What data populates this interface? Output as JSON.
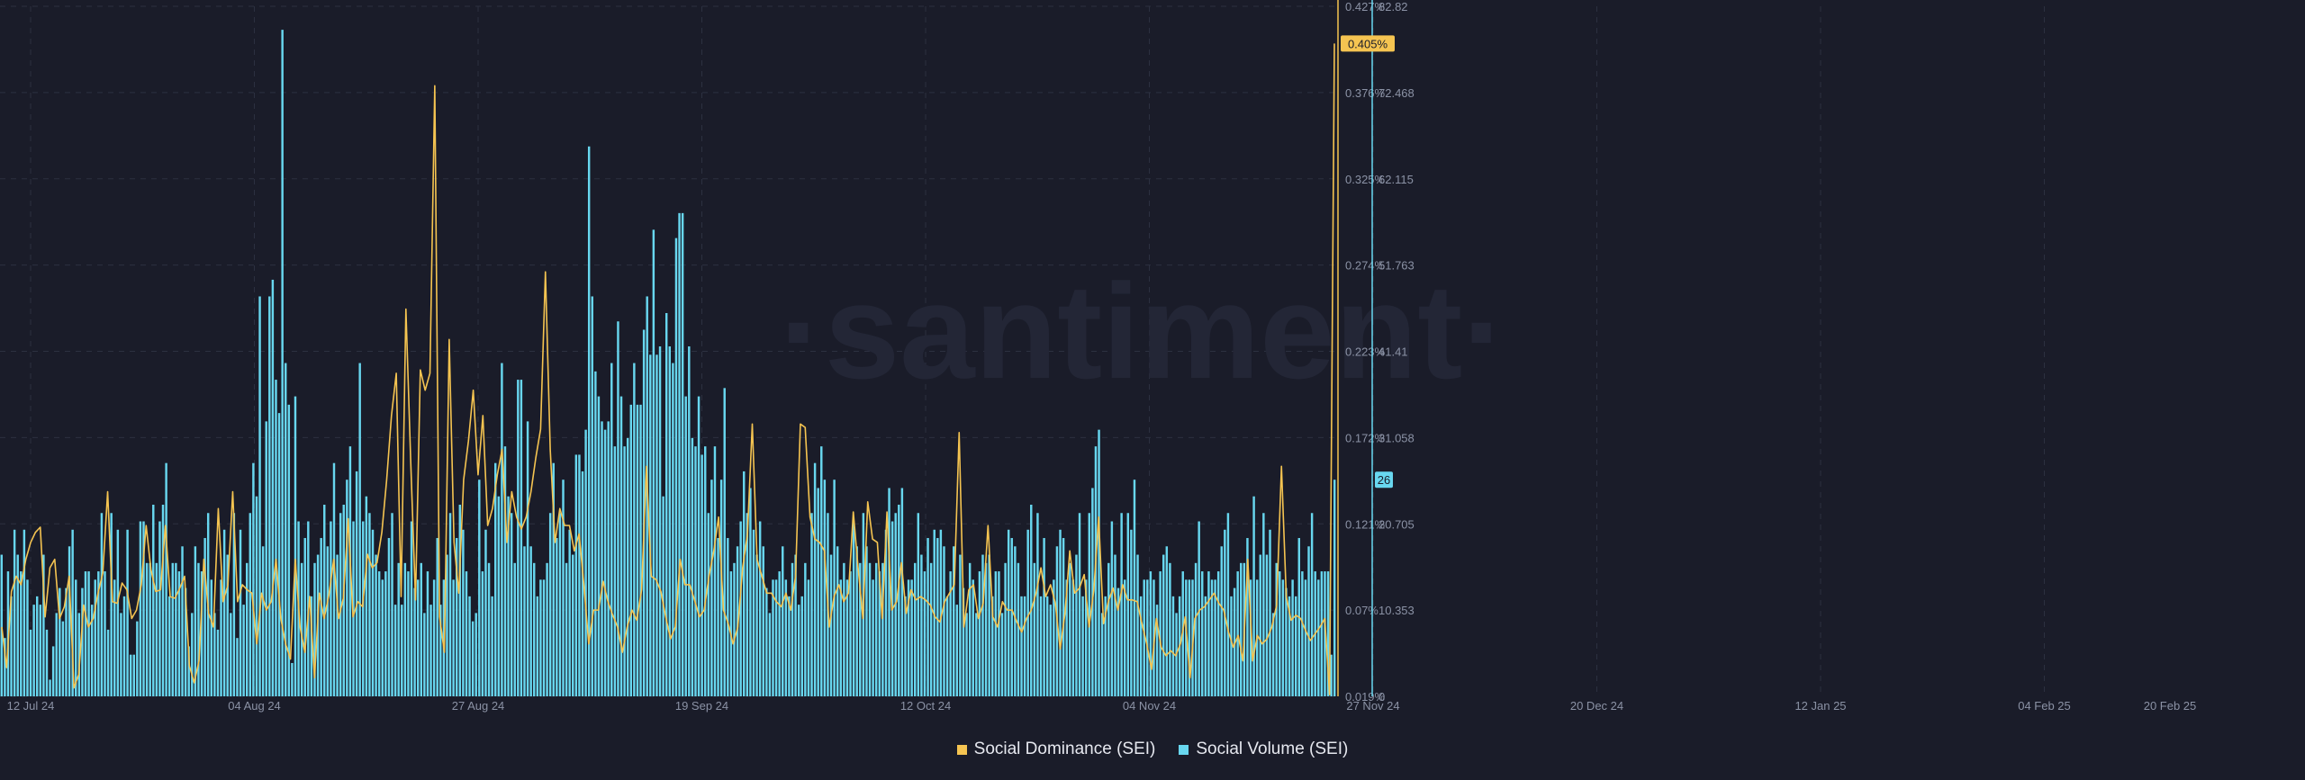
{
  "watermark": "·santiment·",
  "colors": {
    "background": "#1a1c29",
    "grid": "#2c3040",
    "dominance": "#f5c451",
    "volume": "#68d7ef",
    "axis_text": "#8b92a5"
  },
  "chart_data": {
    "type": "bar",
    "x_ticks": [
      "12 Jul 24",
      "04 Aug 24",
      "27 Aug 24",
      "19 Sep 24",
      "12 Oct 24",
      "04 Nov 24",
      "27 Nov 24",
      "20 Dec 24",
      "12 Jan 25",
      "04 Feb 25",
      "20 Feb 25"
    ],
    "y_left_ticks": [
      "0.427%",
      "0.376%",
      "0.325%",
      "0.274%",
      "0.223%",
      "0.172%",
      "0.121%",
      "0.07%",
      "0.019%"
    ],
    "y_right_ticks": [
      "82.82",
      "72.468",
      "62.115",
      "51.763",
      "41.41",
      "31.058",
      "20.705",
      "10.353",
      "0"
    ],
    "y_left_range": [
      0.019,
      0.427
    ],
    "y_right_range": [
      0,
      82.82
    ],
    "current_labels": {
      "dominance": "0.405%",
      "volume": "26"
    },
    "series": [
      {
        "name": "Social Dominance (SEI)",
        "type": "line",
        "axis": "left",
        "values": [
          0.06,
          0.036,
          0.081,
          0.09,
          0.085,
          0.1,
          0.11,
          0.116,
          0.119,
          0.066,
          0.095,
          0.1,
          0.065,
          0.072,
          0.09,
          0.024,
          0.032,
          0.073,
          0.06,
          0.065,
          0.08,
          0.092,
          0.14,
          0.075,
          0.074,
          0.086,
          0.082,
          0.065,
          0.07,
          0.085,
          0.12,
          0.094,
          0.081,
          0.082,
          0.12,
          0.078,
          0.077,
          0.083,
          0.09,
          0.037,
          0.027,
          0.04,
          0.1,
          0.068,
          0.06,
          0.13,
          0.075,
          0.085,
          0.14,
          0.075,
          0.085,
          0.082,
          0.08,
          0.05,
          0.08,
          0.07,
          0.075,
          0.1,
          0.065,
          0.05,
          0.041,
          0.1,
          0.06,
          0.045,
          0.078,
          0.03,
          0.08,
          0.065,
          0.079,
          0.1,
          0.065,
          0.077,
          0.124,
          0.066,
          0.075,
          0.072,
          0.103,
          0.095,
          0.098,
          0.116,
          0.147,
          0.185,
          0.21,
          0.078,
          0.248,
          0.158,
          0.076,
          0.212,
          0.2,
          0.21,
          0.38,
          0.066,
          0.045,
          0.23,
          0.11,
          0.08,
          0.147,
          0.17,
          0.2,
          0.15,
          0.185,
          0.12,
          0.13,
          0.15,
          0.165,
          0.11,
          0.14,
          0.125,
          0.118,
          0.125,
          0.14,
          0.16,
          0.177,
          0.27,
          0.165,
          0.11,
          0.13,
          0.12,
          0.12,
          0.105,
          0.115,
          0.085,
          0.05,
          0.07,
          0.07,
          0.087,
          0.075,
          0.067,
          0.06,
          0.045,
          0.06,
          0.07,
          0.064,
          0.082,
          0.155,
          0.09,
          0.088,
          0.081,
          0.066,
          0.053,
          0.06,
          0.1,
          0.085,
          0.085,
          0.076,
          0.066,
          0.07,
          0.09,
          0.105,
          0.125,
          0.07,
          0.062,
          0.05,
          0.06,
          0.095,
          0.115,
          0.18,
          0.1,
          0.09,
          0.08,
          0.08,
          0.075,
          0.072,
          0.08,
          0.07,
          0.09,
          0.18,
          0.178,
          0.125,
          0.112,
          0.11,
          0.105,
          0.06,
          0.078,
          0.085,
          0.075,
          0.08,
          0.128,
          0.095,
          0.065,
          0.134,
          0.112,
          0.11,
          0.065,
          0.128,
          0.07,
          0.075,
          0.098,
          0.068,
          0.082,
          0.076,
          0.078,
          0.076,
          0.073,
          0.066,
          0.063,
          0.075,
          0.08,
          0.085,
          0.175,
          0.06,
          0.082,
          0.085,
          0.065,
          0.074,
          0.12,
          0.066,
          0.06,
          0.075,
          0.07,
          0.07,
          0.063,
          0.057,
          0.065,
          0.07,
          0.08,
          0.095,
          0.078,
          0.085,
          0.074,
          0.047,
          0.068,
          0.105,
          0.08,
          0.083,
          0.091,
          0.06,
          0.082,
          0.125,
          0.062,
          0.075,
          0.083,
          0.07,
          0.085,
          0.076,
          0.076,
          0.075,
          0.062,
          0.05,
          0.035,
          0.065,
          0.048,
          0.043,
          0.046,
          0.043,
          0.05,
          0.066,
          0.03,
          0.065,
          0.07,
          0.072,
          0.076,
          0.08,
          0.074,
          0.07,
          0.057,
          0.048,
          0.055,
          0.04,
          0.1,
          0.04,
          0.055,
          0.05,
          0.053,
          0.06,
          0.073,
          0.155,
          0.078,
          0.064,
          0.067,
          0.065,
          0.058,
          0.052,
          0.056,
          0.06,
          0.065,
          0.02,
          0.405
        ]
      },
      {
        "name": "Social Volume (SEI)",
        "type": "bar",
        "axis": "right",
        "values": [
          17,
          7,
          15,
          12,
          20,
          17,
          15,
          20,
          14,
          8,
          11,
          12,
          11,
          17,
          8,
          2,
          6,
          10,
          13,
          9,
          13,
          18,
          20,
          14,
          10,
          13,
          15,
          15,
          11,
          14,
          15,
          22,
          15,
          8,
          22,
          14,
          20,
          10,
          12,
          20,
          5,
          5,
          9,
          21,
          21,
          16,
          16,
          23,
          16,
          21,
          23,
          28,
          12,
          16,
          16,
          15,
          18,
          13,
          6,
          10,
          18,
          16,
          15,
          19,
          22,
          14,
          10,
          8,
          14,
          20,
          17,
          10,
          22,
          7,
          20,
          11,
          16,
          22,
          28,
          24,
          48,
          18,
          33,
          48,
          50,
          38,
          34,
          80,
          40,
          35,
          4,
          36,
          21,
          16,
          19,
          21,
          12,
          16,
          17,
          19,
          23,
          18,
          21,
          28,
          17,
          22,
          23,
          26,
          30,
          21,
          27,
          40,
          21,
          24,
          22,
          20,
          17,
          15,
          14,
          15,
          19,
          22,
          11,
          16,
          11,
          16,
          15,
          21,
          13,
          14,
          16,
          10,
          15,
          11,
          14,
          19,
          11,
          14,
          17,
          22,
          14,
          19,
          23,
          20,
          15,
          12,
          9,
          10,
          26,
          15,
          20,
          16,
          12,
          28,
          24,
          40,
          30,
          24,
          22,
          16,
          38,
          38,
          18,
          33,
          18,
          16,
          12,
          14,
          14,
          16,
          22,
          28,
          19,
          22,
          26,
          16,
          20,
          17,
          29,
          29,
          27,
          32,
          66,
          48,
          39,
          36,
          33,
          32,
          33,
          40,
          30,
          45,
          36,
          30,
          31,
          35,
          40,
          35,
          35,
          44,
          48,
          41,
          56,
          41,
          42,
          24,
          46,
          42,
          40,
          55,
          58,
          58,
          36,
          42,
          31,
          30,
          36,
          29,
          30,
          22,
          26,
          30,
          19,
          26,
          37,
          19,
          15,
          16,
          18,
          21,
          27,
          22,
          25,
          20,
          17,
          21,
          18,
          13,
          10,
          14,
          14,
          15,
          18,
          14,
          12,
          16,
          17,
          11,
          12,
          16,
          14,
          22,
          28,
          25,
          30,
          26,
          22,
          17,
          26,
          18,
          14,
          16,
          14,
          15,
          21,
          18,
          16,
          22,
          18,
          16,
          14,
          16,
          15,
          16,
          20,
          25,
          21,
          22,
          23,
          25,
          12,
          14,
          14,
          16,
          22,
          17,
          15,
          19,
          16,
          20,
          19,
          20,
          18,
          12,
          15,
          18,
          11,
          17,
          13,
          10,
          16,
          14,
          10,
          15,
          17,
          16,
          17,
          12,
          15,
          15,
          10,
          16,
          20,
          19,
          18,
          16,
          12,
          12,
          20,
          23,
          16,
          22,
          12,
          19,
          12,
          11,
          14,
          18,
          20,
          19,
          14,
          16,
          14,
          17,
          22,
          12,
          14,
          22,
          25,
          30,
          32,
          10,
          12,
          16,
          21,
          17,
          13,
          22,
          14,
          22,
          20,
          26,
          17,
          12,
          14,
          14,
          15,
          14,
          11,
          15,
          17,
          18,
          16,
          12,
          10,
          12,
          15,
          14,
          14,
          14,
          16,
          21,
          15,
          12,
          15,
          14,
          14,
          15,
          18,
          20,
          22,
          12,
          13,
          15,
          16,
          16,
          19,
          14,
          24,
          14,
          17,
          22,
          17,
          20,
          10,
          16,
          15,
          14,
          13,
          12,
          14,
          12,
          19,
          15,
          14,
          18,
          22,
          15,
          14,
          15,
          15,
          15,
          5,
          26
        ]
      }
    ]
  }
}
